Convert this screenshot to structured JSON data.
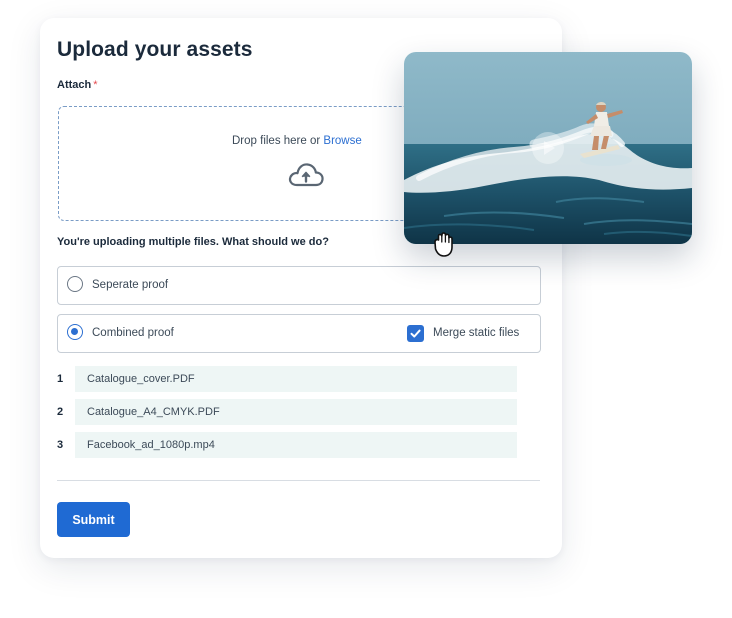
{
  "form": {
    "title": "Upload your assets",
    "attach_label": "Attach",
    "required_mark": "*",
    "dropzone": {
      "text": "Drop files here or ",
      "browse_link": "Browse",
      "icon": "cloud-upload-icon"
    },
    "question": "You're uploading multiple files. What should we do?",
    "options": [
      {
        "label": "Seperate proof",
        "selected": false
      },
      {
        "label": "Combined proof",
        "selected": true
      }
    ],
    "merge_checkbox": {
      "label": "Merge static files",
      "checked": true
    },
    "files": [
      {
        "index": "1",
        "name": "Catalogue_cover.PDF"
      },
      {
        "index": "2",
        "name": "Catalogue_A4_CMYK.PDF"
      },
      {
        "index": "3",
        "name": "Facebook_ad_1080p.mp4"
      }
    ],
    "submit_label": "Submit"
  },
  "preview": {
    "icons": [
      "play-icon"
    ],
    "cursor": "grab-hand-icon"
  },
  "colors": {
    "accent": "#1f6ad3",
    "link": "#2c6fd1",
    "file_row_bg": "#eef6f5",
    "required": "#e5484d"
  }
}
